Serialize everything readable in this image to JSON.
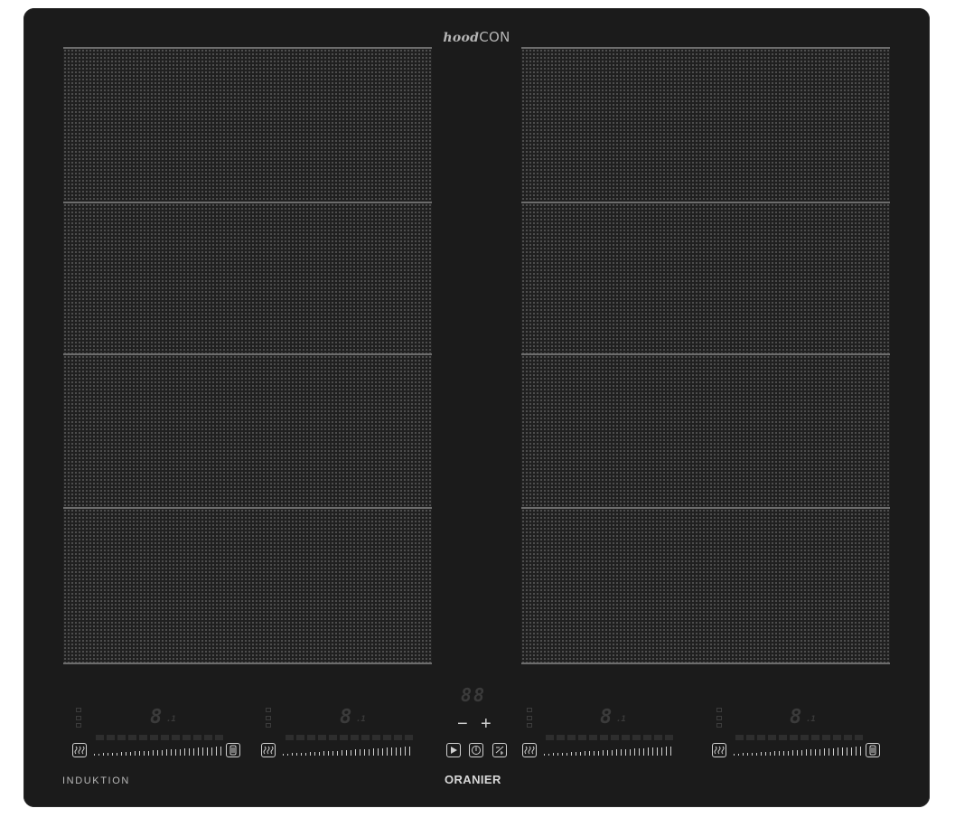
{
  "hob": {
    "brand": {
      "prefix": "hood",
      "suffix": "CON"
    },
    "left_label": "INDUKTION",
    "logo": "ORANIER",
    "timer_display": "88",
    "zones": [
      {
        "display": "8",
        "display_small": ".1"
      },
      {
        "display": "8",
        "display_small": ".1"
      },
      {
        "display": "8",
        "display_small": ".1"
      },
      {
        "display": "8",
        "display_small": ".1"
      }
    ],
    "controls": {
      "minus": "−",
      "plus": "+"
    }
  }
}
